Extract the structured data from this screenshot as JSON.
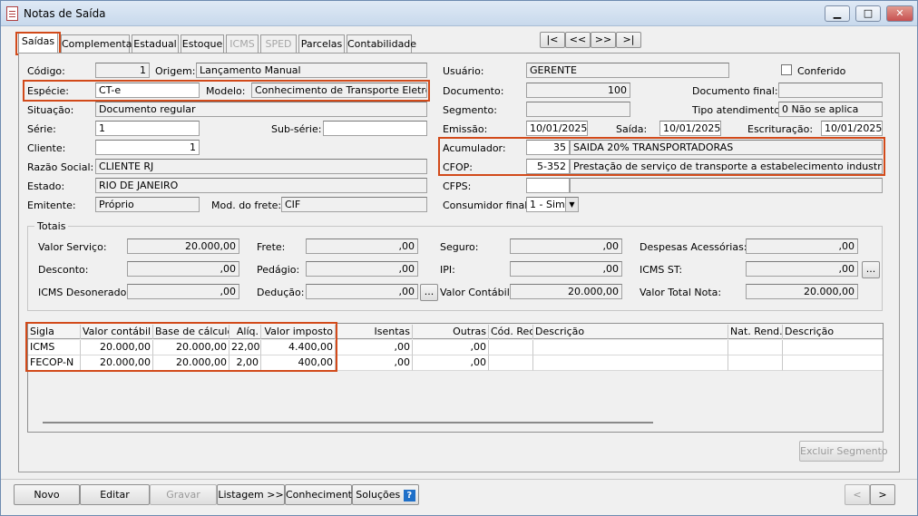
{
  "window": {
    "title": "Notas de Saída",
    "minimize_icon": "minimize-icon",
    "maximize_icon": "maximize-icon",
    "close_icon": "close-icon",
    "close_color": "#c75050"
  },
  "tabs": [
    "Saídas",
    "Complementar",
    "Estadual",
    "Estoque",
    "ICMS",
    "SPED",
    "Parcelas",
    "Contabilidade"
  ],
  "nav": {
    "first": "|<",
    "prev": "<<",
    "next": ">>",
    "last": ">|"
  },
  "form": {
    "codigo_label": "Código:",
    "codigo": "1",
    "origem_label": "Origem:",
    "origem": "Lançamento Manual",
    "especie_label": "Espécie:",
    "especie": "CT-e",
    "modelo_label": "Modelo:",
    "modelo": "Conhecimento de Transporte Eletrônico -",
    "situacao_label": "Situação:",
    "situacao": "Documento regular",
    "serie_label": "Série:",
    "serie": "1",
    "subserie_label": "Sub-série:",
    "subserie": "",
    "cliente_label": "Cliente:",
    "cliente": "1",
    "razao_label": "Razão Social:",
    "razao": "CLIENTE RJ",
    "estado_label": "Estado:",
    "estado": "RIO DE JANEIRO",
    "emitente_label": "Emitente:",
    "emitente": "Próprio",
    "modfrete_label": "Mod. do frete:",
    "modfrete": "CIF",
    "usuario_label": "Usuário:",
    "usuario": "GERENTE",
    "conferido_label": "Conferido",
    "documento_label": "Documento:",
    "documento": "100",
    "docfinal_label": "Documento final:",
    "docfinal": "",
    "segmento_label": "Segmento:",
    "segmento": "",
    "tipoatend_label": "Tipo atendimento:",
    "tipoatend": "0 Não se aplica",
    "emissao_label": "Emissão:",
    "emissao": "10/01/2025",
    "saida_label": "Saída:",
    "saida": "10/01/2025",
    "escrituracao_label": "Escrituração:",
    "escrituracao": "10/01/2025",
    "acumulador_label": "Acumulador:",
    "acumulador_code": "35",
    "acumulador_desc": "SAIDA 20% TRANSPORTADORAS",
    "cfop_label": "CFOP:",
    "cfop_code": "5-352",
    "cfop_desc": "Prestação de serviço de transporte a estabelecimento industrial",
    "cfps_label": "CFPS:",
    "consumidor_label": "Consumidor final:",
    "consumidor": "1 - Sim"
  },
  "totais": {
    "title": "Totais",
    "valor_servico_label": "Valor Serviço:",
    "valor_servico": "20.000,00",
    "frete_label": "Frete:",
    "frete": ",00",
    "seguro_label": "Seguro:",
    "seguro": ",00",
    "despesas_label": "Despesas Acessórias:",
    "despesas": ",00",
    "desconto_label": "Desconto:",
    "desconto": ",00",
    "pedagio_label": "Pedágio:",
    "pedagio": ",00",
    "ipi_label": "IPI:",
    "ipi": ",00",
    "icmsst_label": "ICMS ST:",
    "icmsst": ",00",
    "icmsdeson_label": "ICMS Desonerado:",
    "icmsdeson": ",00",
    "deducao_label": "Dedução:",
    "deducao": ",00",
    "valor_contabil_label": "Valor Contábil:",
    "valor_contabil": "20.000,00",
    "valor_total_label": "Valor Total Nota:",
    "valor_total": "20.000,00",
    "ellipsis": "..."
  },
  "grid": {
    "headers": [
      "Sigla",
      "Valor contábil",
      "Base de cálculo",
      "Alíq.",
      "Valor imposto",
      "Isentas",
      "Outras",
      "Cód. Rec.",
      "Descrição",
      "Nat. Rend.",
      "Descrição"
    ],
    "rows": [
      [
        "ICMS",
        "20.000,00",
        "20.000,00",
        "22,00",
        "4.400,00",
        ",00",
        ",00",
        "",
        "",
        "",
        ""
      ],
      [
        "FECOP-N",
        "20.000,00",
        "20.000,00",
        "2,00",
        "400,00",
        ",00",
        ",00",
        "",
        "",
        "",
        ""
      ]
    ]
  },
  "buttons": {
    "excluir": "Excluir Segmento",
    "novo": "Novo",
    "editar": "Editar",
    "gravar": "Gravar",
    "listagem": "Listagem >>",
    "conhecimento": "Conhecimento",
    "solucoes": "Soluções",
    "help_icon": "?",
    "back": "<",
    "forward": ">"
  },
  "highlight_color": "#d24a1a"
}
